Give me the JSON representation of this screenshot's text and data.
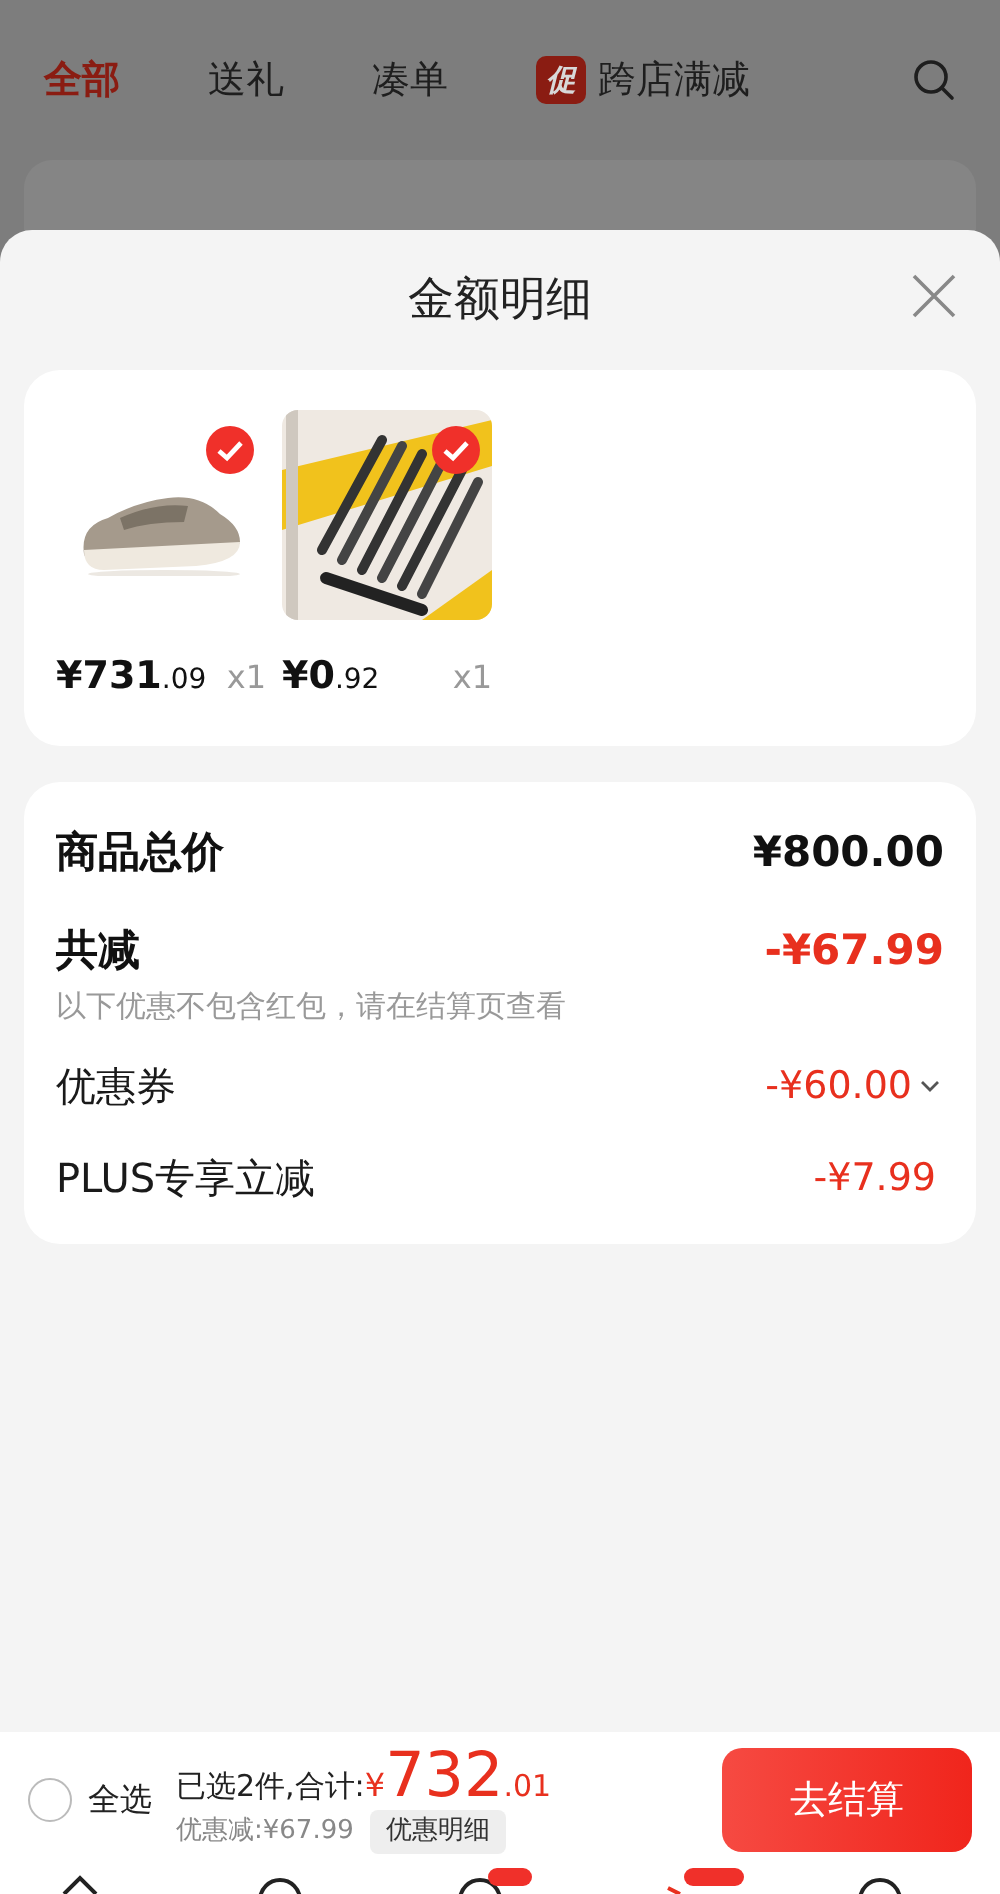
{
  "top_tabs": [
    {
      "label": "全部",
      "selected": true
    },
    {
      "label": "送礼",
      "selected": false
    },
    {
      "label": "凑单",
      "selected": false
    },
    {
      "label": "跨店满减",
      "selected": false,
      "tag": "促"
    }
  ],
  "sheet": {
    "title": "金额明细"
  },
  "products": [
    {
      "kind": "shoe",
      "price_int": "¥731",
      "price_dec": ".09",
      "qty": "x1",
      "checked": true
    },
    {
      "kind": "pens",
      "price_int": "¥0",
      "price_dec": ".92",
      "qty": "x1",
      "checked": true
    }
  ],
  "summary": [
    {
      "kind": "total",
      "label": "商品总价",
      "amount": "¥800.00"
    },
    {
      "kind": "reduction",
      "label": "共减",
      "amount": "-¥67.99",
      "note": "以下优惠不包含红包，请在结算页查看"
    },
    {
      "kind": "item",
      "label": "优惠券",
      "amount": "-¥60.00",
      "expandable": true
    },
    {
      "kind": "item",
      "label": "PLUS专享立减",
      "amount": "-¥7.99",
      "expandable": false
    }
  ],
  "checkout": {
    "select_all": {
      "label": "全选",
      "checked": false
    },
    "summary": "已选2件,合计:",
    "currency": "¥",
    "total_int": "732",
    "total_dec": ".01",
    "discount": "优惠减:¥67.99",
    "detail_button": "优惠明细",
    "button": "去结算"
  }
}
